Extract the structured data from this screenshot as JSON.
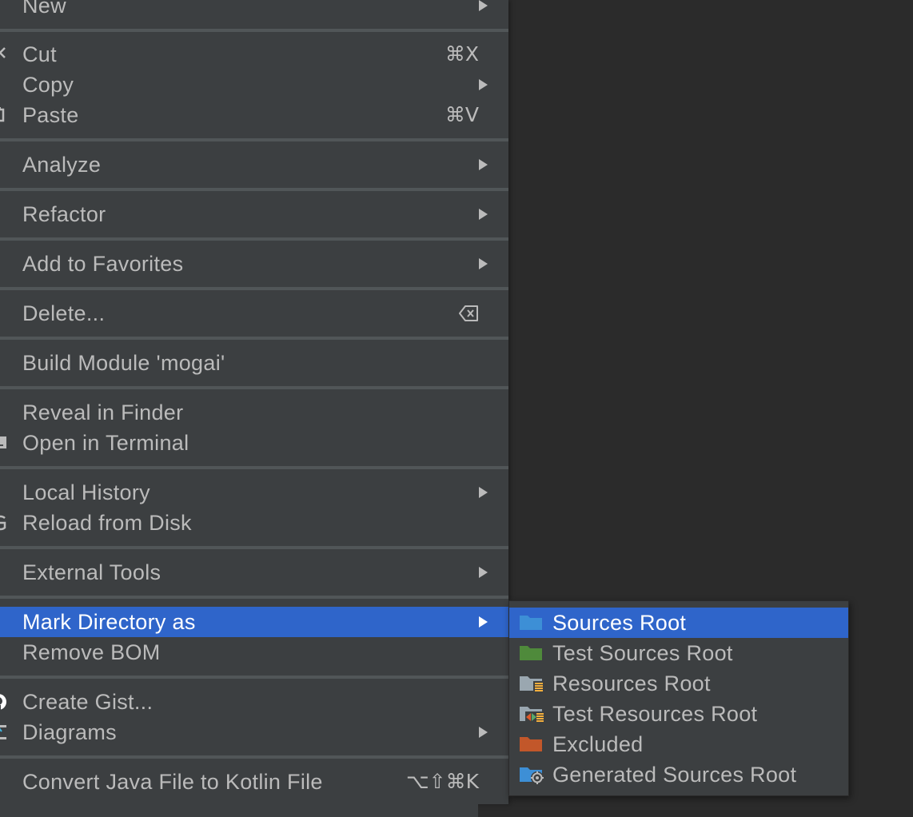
{
  "menu": {
    "items": [
      {
        "label": "New",
        "submenu": true
      },
      {
        "label": "Cut",
        "shortcut": "⌘X"
      },
      {
        "label": "Copy",
        "submenu": true
      },
      {
        "label": "Paste",
        "shortcut": "⌘V"
      },
      {
        "label": "Analyze",
        "submenu": true
      },
      {
        "label": "Refactor",
        "submenu": true
      },
      {
        "label": "Add to Favorites",
        "submenu": true
      },
      {
        "label": "Delete...",
        "shortcut_icon": "backspace-icon"
      },
      {
        "label": "Build Module 'mogai'"
      },
      {
        "label": "Reveal in Finder"
      },
      {
        "label": "Open in Terminal"
      },
      {
        "label": "Local History",
        "submenu": true
      },
      {
        "label": "Reload from Disk"
      },
      {
        "label": "External Tools",
        "submenu": true
      },
      {
        "label": "Mark Directory as",
        "submenu": true,
        "selected": true
      },
      {
        "label": "Remove BOM"
      },
      {
        "label": "Create Gist..."
      },
      {
        "label": "Diagrams",
        "submenu": true
      },
      {
        "label": "Convert Java File to Kotlin File",
        "shortcut": "⌥⇧⌘K"
      }
    ]
  },
  "submenu": {
    "items": [
      {
        "label": "Sources Root",
        "icon": "sources-root-folder-icon",
        "selected": true
      },
      {
        "label": "Test Sources Root",
        "icon": "test-sources-root-folder-icon"
      },
      {
        "label": "Resources Root",
        "icon": "resources-root-folder-icon"
      },
      {
        "label": "Test Resources Root",
        "icon": "test-resources-root-folder-icon"
      },
      {
        "label": "Excluded",
        "icon": "excluded-folder-icon"
      },
      {
        "label": "Generated Sources Root",
        "icon": "generated-sources-root-folder-icon"
      }
    ]
  },
  "colors": {
    "menu_background": "#3c3f41",
    "selection": "#2f65ca",
    "text": "#bbbbbb",
    "separator": "#515658",
    "editor_background": "#2b2b2b",
    "sources_folder": "#3d8fd6",
    "test_sources_folder": "#4f8a3b",
    "excluded_folder": "#c2572a"
  }
}
